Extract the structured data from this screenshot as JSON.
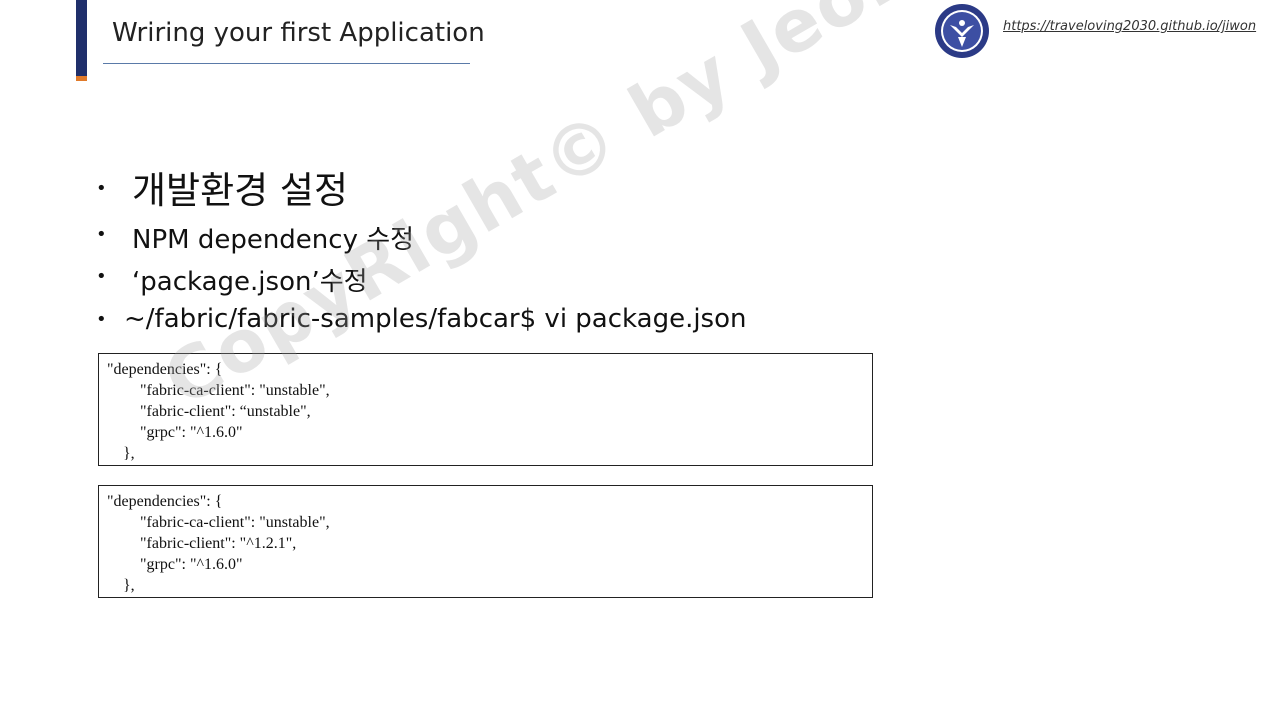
{
  "header": {
    "title": "Wriring your first Application",
    "link": "https://traveloving2030.github.io/jiwon",
    "logo": "university-emblem-icon",
    "accent_color": "#1f2f6b",
    "accent_secondary_color": "#e07a2a"
  },
  "bullets": [
    {
      "text": "개발환경 설정"
    },
    {
      "text": "NPM dependency 수정"
    },
    {
      "text": "‘package.json’수정"
    },
    {
      "text": "~/fabric/fabric-samples/fabcar$ vi package.json"
    }
  ],
  "code_blocks": [
    {
      "lines": [
        "\"dependencies\": {",
        "\"fabric-ca-client\": \"unstable\",",
        "\"fabric-client\": “unstable\",",
        "\"grpc\": \"^1.6.0\"",
        "},"
      ]
    },
    {
      "lines": [
        "\"dependencies\": {",
        "\"fabric-ca-client\": \"unstable\",",
        "\"fabric-client\": \"^1.2.1\",",
        "\"grpc\": \"^1.6.0\"",
        "},"
      ]
    }
  ],
  "watermark": "CopyRight© by Jeong JiWon"
}
